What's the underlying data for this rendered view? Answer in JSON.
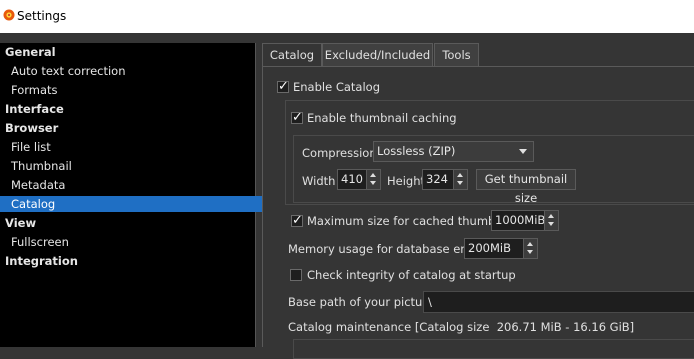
{
  "window": {
    "title": "Settings"
  },
  "sidebar": {
    "items": [
      {
        "label": "General",
        "kind": "cat"
      },
      {
        "label": "Auto text correction",
        "kind": "sub"
      },
      {
        "label": "Formats",
        "kind": "sub"
      },
      {
        "label": "Interface",
        "kind": "cat"
      },
      {
        "label": "Browser",
        "kind": "cat"
      },
      {
        "label": "File list",
        "kind": "sub"
      },
      {
        "label": "Thumbnail",
        "kind": "sub"
      },
      {
        "label": "Metadata",
        "kind": "sub"
      },
      {
        "label": "Catalog",
        "kind": "sub",
        "selected": true
      },
      {
        "label": "View",
        "kind": "cat"
      },
      {
        "label": "Fullscreen",
        "kind": "sub"
      },
      {
        "label": "Integration",
        "kind": "cat"
      }
    ]
  },
  "tabs": [
    {
      "label": "Catalog",
      "active": true
    },
    {
      "label": "Excluded/Included"
    },
    {
      "label": "Tools"
    }
  ],
  "catalog": {
    "enable_catalog": {
      "label": "Enable Catalog",
      "checked": true
    },
    "enable_thumb_cache": {
      "label": "Enable thumbnail caching",
      "checked": true
    },
    "compression": {
      "label": "Compression:",
      "value": "Lossless (ZIP)"
    },
    "width": {
      "label": "Width",
      "value": "410"
    },
    "height": {
      "label": "Height",
      "value": "324"
    },
    "get_thumb_size": "Get thumbnail size",
    "max_size": {
      "label": "Maximum size for cached thumbnails",
      "checked": true,
      "value": "1000MiB"
    },
    "memory_usage": {
      "label": "Memory usage for database engine",
      "value": "200MiB"
    },
    "check_integrity": {
      "label": "Check integrity of catalog at startup",
      "checked": false
    },
    "base_path": {
      "label": "Base path of your pictures",
      "value": "\\"
    },
    "maintenance": "Catalog maintenance [Catalog size  206.71 MiB - 16.16 GiB]"
  },
  "colors": {
    "selection": "#1f6fc4",
    "background": "#353535",
    "sidebar": "#000000"
  }
}
